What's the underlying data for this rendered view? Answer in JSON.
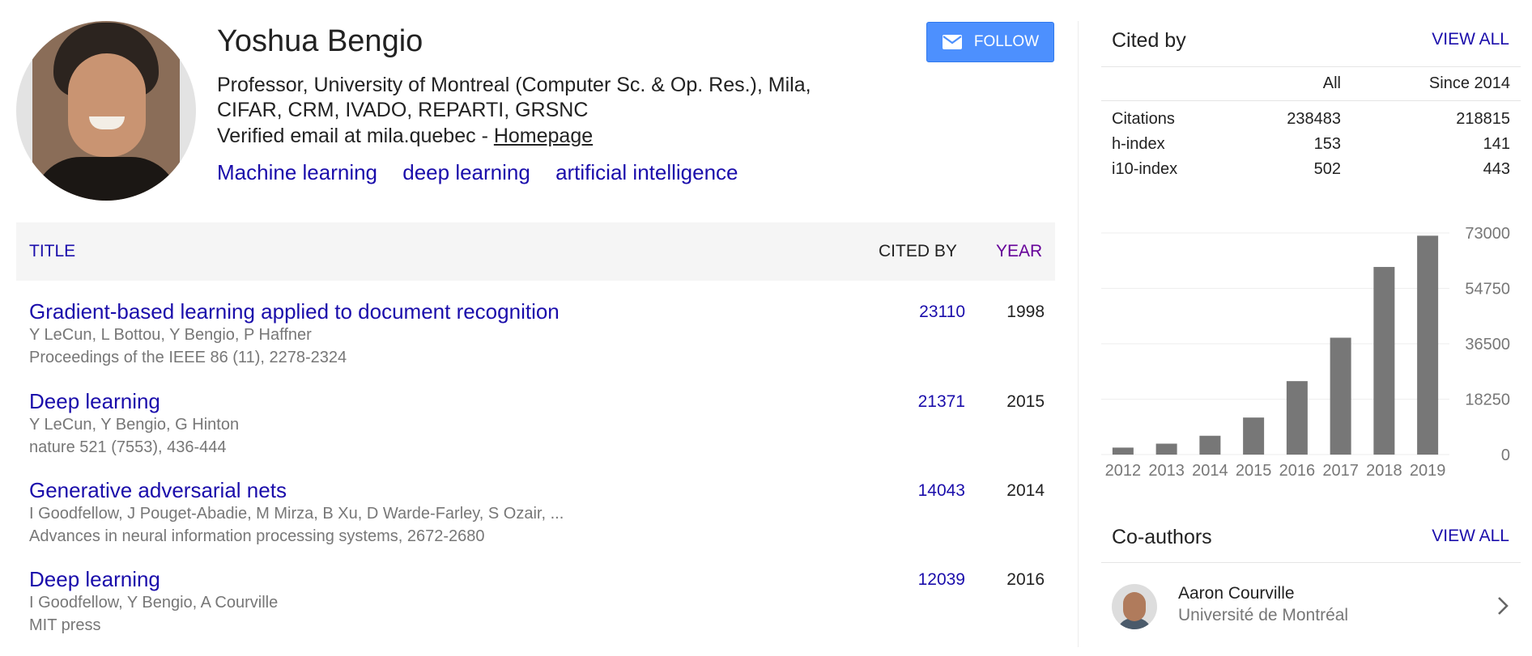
{
  "profile": {
    "name": "Yoshua Bengio",
    "affiliation": "Professor, University of Montreal (Computer Sc. & Op. Res.), Mila, CIFAR, CRM, IVADO, REPARTI, GRSNC",
    "email_text": "Verified email at mila.quebec - ",
    "homepage_label": "Homepage",
    "interests": [
      "Machine learning",
      "deep learning",
      "artificial intelligence"
    ],
    "follow_label": "FOLLOW"
  },
  "articles_table": {
    "headers": {
      "title": "TITLE",
      "cited_by": "CITED BY",
      "year": "YEAR"
    },
    "rows": [
      {
        "title": "Gradient-based learning applied to document recognition",
        "authors": "Y LeCun, L Bottou, Y Bengio, P Haffner",
        "venue": "Proceedings of the IEEE 86 (11), 2278-2324",
        "cited_by": "23110",
        "year": "1998"
      },
      {
        "title": "Deep learning",
        "authors": "Y LeCun, Y Bengio, G Hinton",
        "venue": "nature 521 (7553), 436-444",
        "cited_by": "21371",
        "year": "2015"
      },
      {
        "title": "Generative adversarial nets",
        "authors": "I Goodfellow, J Pouget-Abadie, M Mirza, B Xu, D Warde-Farley, S Ozair, ...",
        "venue": "Advances in neural information processing systems, 2672-2680",
        "cited_by": "14043",
        "year": "2014"
      },
      {
        "title": "Deep learning",
        "authors": "I Goodfellow, Y Bengio, A Courville",
        "venue": "MIT press",
        "cited_by": "12039",
        "year": "2016"
      }
    ]
  },
  "cited_by": {
    "title": "Cited by",
    "view_all": "VIEW ALL",
    "columns": [
      "",
      "All",
      "Since 2014"
    ],
    "rows": [
      {
        "label": "Citations",
        "all": "238483",
        "since": "218815"
      },
      {
        "label": "h-index",
        "all": "153",
        "since": "141"
      },
      {
        "label": "i10-index",
        "all": "502",
        "since": "443"
      }
    ]
  },
  "chart_data": {
    "type": "bar",
    "categories": [
      "2012",
      "2013",
      "2014",
      "2015",
      "2016",
      "2017",
      "2018",
      "2019"
    ],
    "values": [
      2300,
      3600,
      6200,
      12200,
      24200,
      38500,
      61800,
      72100
    ],
    "y_ticks": [
      "0",
      "18250",
      "36500",
      "54750",
      "73000"
    ],
    "ylim": [
      0,
      73000
    ],
    "bar_color": "#777777",
    "grid": true
  },
  "coauthors": {
    "title": "Co-authors",
    "view_all": "VIEW ALL",
    "items": [
      {
        "name": "Aaron Courville",
        "affiliation": "Université de Montréal"
      }
    ]
  }
}
